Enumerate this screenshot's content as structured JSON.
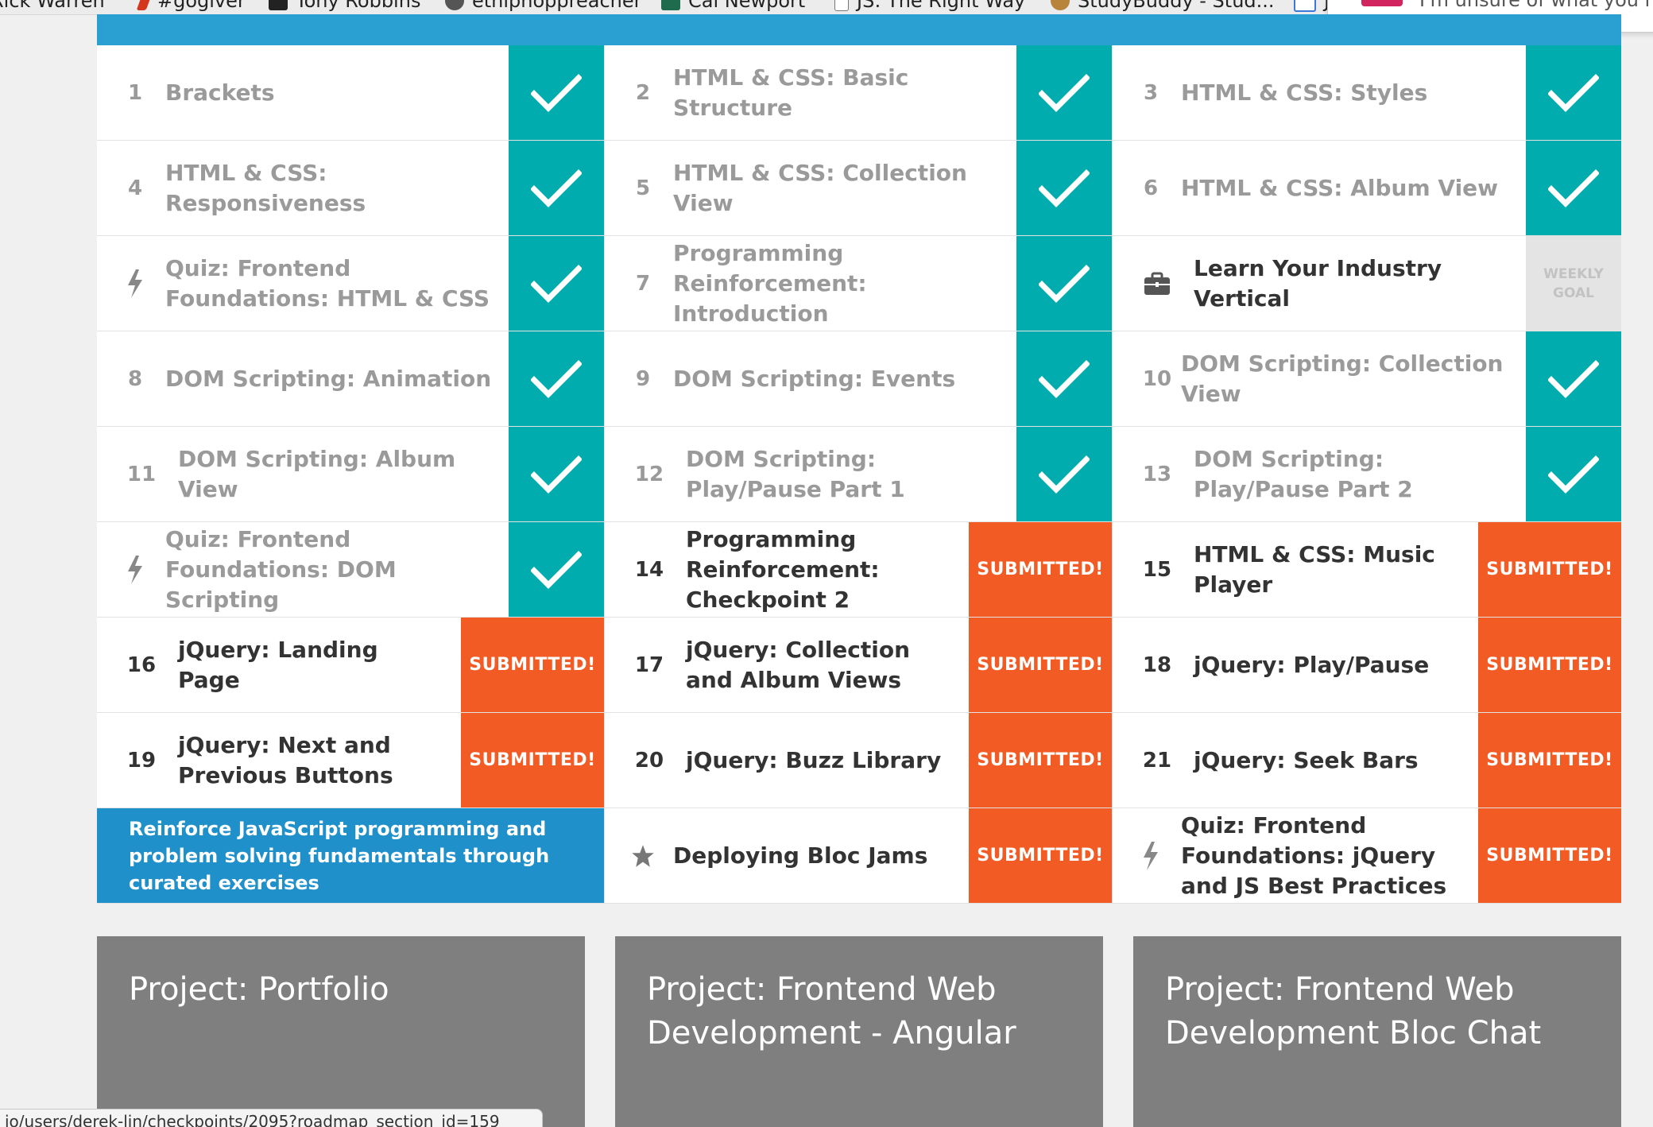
{
  "bookmarks": [
    {
      "label": "Rick Warren",
      "icon": "page-icon"
    },
    {
      "label": "#gogiver",
      "icon": "feather-icon"
    },
    {
      "label": "Tony Robbins",
      "icon": "tr-logo-icon"
    },
    {
      "label": "ethiphoppreacher",
      "icon": "globe-icon"
    },
    {
      "label": "Cal Newport",
      "icon": "cn-logo-icon"
    },
    {
      "label": "JS: The Right Way",
      "icon": "page-icon"
    },
    {
      "label": "StudyBuddy - Stud...",
      "icon": "cookie-icon"
    },
    {
      "label": "Js",
      "icon": "js-icon"
    }
  ],
  "popup_text": "I'm unsure of what you mea",
  "checkpoints": [
    {
      "marker": "1",
      "title": "Brackets",
      "status": "check"
    },
    {
      "marker": "2",
      "title": "HTML & CSS: Basic Structure",
      "status": "check"
    },
    {
      "marker": "3",
      "title": "HTML & CSS: Styles",
      "status": "check"
    },
    {
      "marker": "4",
      "title": "HTML & CSS: Responsiveness",
      "status": "check"
    },
    {
      "marker": "5",
      "title": "HTML & CSS: Collection View",
      "status": "check"
    },
    {
      "marker": "6",
      "title": "HTML & CSS: Album View",
      "status": "check"
    },
    {
      "marker": "bolt",
      "title": "Quiz: Frontend Foundations: HTML & CSS",
      "status": "check"
    },
    {
      "marker": "7",
      "title": "Programming Reinforcement: Introduction",
      "status": "check"
    },
    {
      "marker": "briefcase",
      "title": "Learn Your Industry Vertical",
      "status": "weekly"
    },
    {
      "marker": "8",
      "title": "DOM Scripting: Animation",
      "status": "check"
    },
    {
      "marker": "9",
      "title": "DOM Scripting: Events",
      "status": "check"
    },
    {
      "marker": "10",
      "title": "DOM Scripting: Collection View",
      "status": "check"
    },
    {
      "marker": "11",
      "title": "DOM Scripting: Album View",
      "status": "check"
    },
    {
      "marker": "12",
      "title": "DOM Scripting: Play/Pause Part 1",
      "status": "check"
    },
    {
      "marker": "13",
      "title": "DOM Scripting: Play/Pause Part 2",
      "status": "check"
    },
    {
      "marker": "bolt",
      "title": "Quiz: Frontend Foundations: DOM Scripting",
      "status": "check"
    },
    {
      "marker": "14",
      "title": "Programming Reinforcement: Checkpoint 2",
      "status": "submitted"
    },
    {
      "marker": "15",
      "title": "HTML & CSS: Music Player",
      "status": "submitted"
    },
    {
      "marker": "16",
      "title": "jQuery: Landing Page",
      "status": "submitted"
    },
    {
      "marker": "17",
      "title": "jQuery: Collection and Album Views",
      "status": "submitted"
    },
    {
      "marker": "18",
      "title": "jQuery: Play/Pause",
      "status": "submitted"
    },
    {
      "marker": "19",
      "title": "jQuery: Next and Previous Buttons",
      "status": "submitted"
    },
    {
      "marker": "20",
      "title": "jQuery: Buzz Library",
      "status": "submitted"
    },
    {
      "marker": "21",
      "title": "jQuery: Seek Bars",
      "status": "submitted"
    },
    {
      "marker": "blue",
      "title": "Reinforce JavaScript programming and problem solving fundamentals through curated exercises",
      "status": "none"
    },
    {
      "marker": "star",
      "title": "Deploying Bloc Jams",
      "status": "submitted"
    },
    {
      "marker": "bolt",
      "title": "Quiz: Frontend Foundations: jQuery and JS Best Practices",
      "status": "submitted"
    }
  ],
  "labels": {
    "submitted": "SUBMITTED!",
    "weekly_line1": "WEEKLY",
    "weekly_line2": "GOAL"
  },
  "colors": {
    "complete": "#00acad",
    "submitted": "#f25b24",
    "info_blue": "#2090cb",
    "project_card": "#7f7f7f"
  },
  "projects": [
    {
      "title": "Project: Portfolio"
    },
    {
      "title": "Project: Frontend Web Development - Angular"
    },
    {
      "title": "Project: Frontend Web Development Bloc Chat"
    }
  ],
  "status_url": "io/users/derek-lin/checkpoints/2095?roadmap_section_id=159"
}
